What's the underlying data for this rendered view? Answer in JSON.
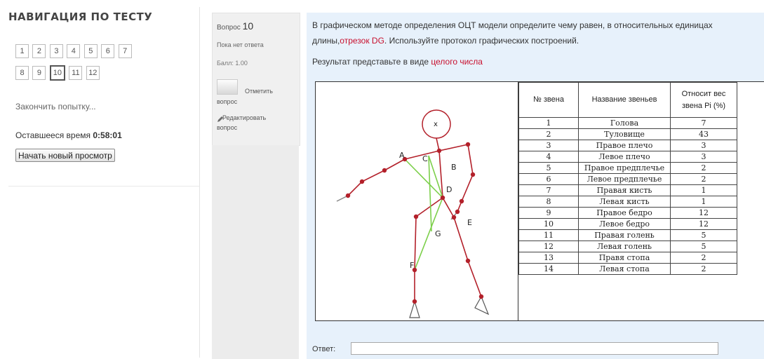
{
  "nav": {
    "title": "НАВИГАЦИЯ ПО ТЕСТУ",
    "questions": [
      "1",
      "2",
      "3",
      "4",
      "5",
      "6",
      "7",
      "8",
      "9",
      "10",
      "11",
      "12"
    ],
    "current": "10",
    "finish_link": "Закончить попытку...",
    "time_label": "Оставшееся время",
    "time_value": "0:58:01",
    "new_preview": "Начать новый просмотр"
  },
  "info": {
    "question_word": "Вопрос",
    "question_number": "10",
    "state": "Пока нет ответа",
    "grade": "Балл: 1.00",
    "flag_line1": "Отметить",
    "flag_line2": "вопрос",
    "edit_line1": "Редактировать",
    "edit_line2": "вопрос"
  },
  "question": {
    "text_part1": "В графическом методе определения ОЦТ модели определите чему равен, в относительных единицах длины,",
    "text_highlight": "отрезок DG",
    "text_part2": ". Используйте протокол графических построений.",
    "result_text": "Результат представьте в виде",
    "result_highlight": "целого числа"
  },
  "figure": {
    "head_mark": "x",
    "labels": {
      "A": "A",
      "B": "B",
      "C": "C",
      "D": "D",
      "E": "E",
      "F": "F",
      "G": "G"
    }
  },
  "table": {
    "headers": [
      "№ звена",
      "Название звеньев",
      "Относит вес звена Pi (%)"
    ],
    "rows": [
      [
        "1",
        "Голова",
        "7"
      ],
      [
        "2",
        "Туловище",
        "43"
      ],
      [
        "3",
        "Правое плечо",
        "3"
      ],
      [
        "4",
        "Левое плечо",
        "3"
      ],
      [
        "5",
        "Правое предплечье",
        "2"
      ],
      [
        "6",
        "Левое предплечье",
        "2"
      ],
      [
        "7",
        "Правая кисть",
        "1"
      ],
      [
        "8",
        "Левая кисть",
        "1"
      ],
      [
        "9",
        "Правое бедро",
        "12"
      ],
      [
        "10",
        "Левое бедро",
        "12"
      ],
      [
        "11",
        "Правая голень",
        "5"
      ],
      [
        "12",
        "Левая голень",
        "5"
      ],
      [
        "13",
        "Правя стопа",
        "2"
      ],
      [
        "14",
        "Левая стопа",
        "2"
      ]
    ]
  },
  "answer": {
    "label": "Ответ:",
    "value": ""
  },
  "colors": {
    "highlight": "#c8102e",
    "content_bg": "#e7f1fb",
    "stick_red": "#b3202a",
    "stick_green": "#7ccf4a"
  }
}
